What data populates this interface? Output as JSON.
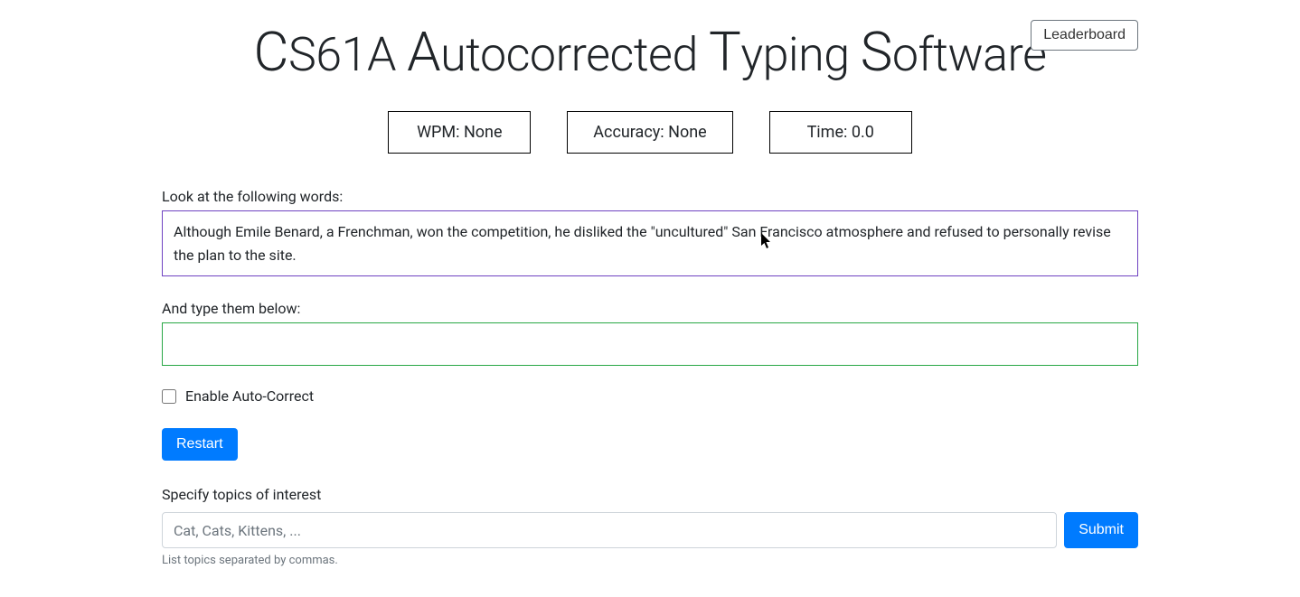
{
  "header": {
    "leaderboard_label": "Leaderboard",
    "title_parts": {
      "c": "C",
      "s61a": "S61A ",
      "a": "A",
      "utocorrected": "utocorrected ",
      "t": "T",
      "yping": "yping ",
      "s": "S",
      "oftware": "oftware"
    }
  },
  "stats": {
    "wpm_label": "WPM: ",
    "wpm_value": "None",
    "accuracy_label": "Accuracy: ",
    "accuracy_value": "None",
    "time_label": "Time: ",
    "time_value": "0.0"
  },
  "prompt": {
    "look_label": "Look at the following words:",
    "text": "Although Emile Benard, a Frenchman, won the competition, he disliked the \"uncultured\" San Francisco atmosphere and refused to personally revise the plan to the site.",
    "type_label": "And type them below:"
  },
  "autocorrect": {
    "label": "Enable Auto-Correct"
  },
  "restart": {
    "label": "Restart"
  },
  "topics": {
    "label": "Specify topics of interest",
    "placeholder": "Cat, Cats, Kittens, ...",
    "submit_label": "Submit",
    "help_text": "List topics separated by commas."
  }
}
